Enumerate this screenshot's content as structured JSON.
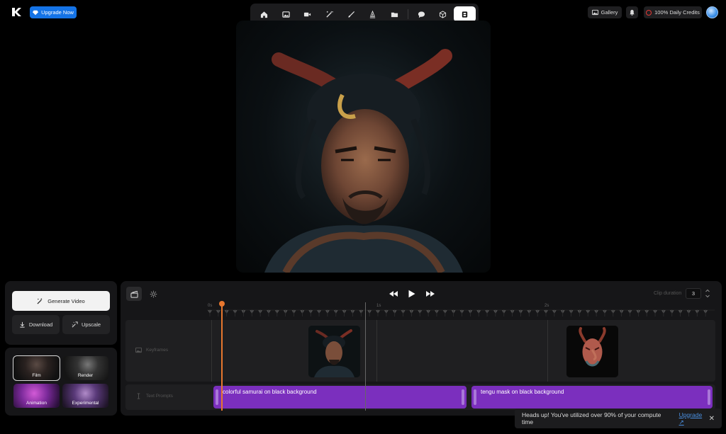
{
  "header": {
    "upgrade_label": "Upgrade Now",
    "gallery_label": "Gallery",
    "credits_label": "100% Daily Credits"
  },
  "toolbar": {
    "tools": [
      "home-icon",
      "image-icon",
      "video-icon",
      "magic-wand-icon",
      "brush-icon",
      "pen-nib-icon",
      "folder-icon",
      "chat-bubble-icon",
      "cube-icon",
      "timeline-editor-icon"
    ],
    "active": "timeline-editor-icon"
  },
  "actions": {
    "generate_label": "Generate Video",
    "download_label": "Download",
    "upscale_label": "Upscale"
  },
  "styles": [
    "Film",
    "Render",
    "Animation",
    "Experimental"
  ],
  "selected_style": "Film",
  "timeline": {
    "clip_duration_label": "Clip duration",
    "clip_duration_value": "3",
    "ruler_labels": [
      "0s",
      "1s",
      "2s"
    ],
    "tracks": {
      "keyframes_label": "Keyframes",
      "text_prompts_label": "Text Prompts"
    },
    "prompts": [
      "colorful samurai on black background",
      "tengu mask on black background"
    ]
  },
  "toast": {
    "message": "Heads up! You've utilized over 90% of your compute time",
    "link": "Upgrade ↗"
  },
  "colors": {
    "accent": "#1473e6",
    "prompt_bar": "#7b2fbe",
    "playhead": "#e8772e",
    "credit_ring": "#e53935"
  }
}
